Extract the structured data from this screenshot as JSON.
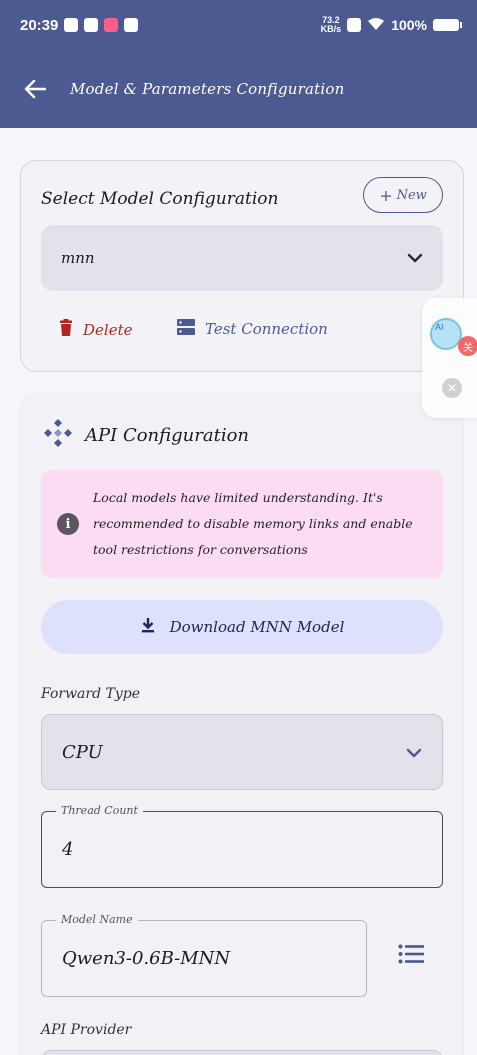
{
  "status_bar": {
    "time": "20:39",
    "net_speed_value": "73.2",
    "net_speed_unit": "KB/s",
    "battery": "100%"
  },
  "app_bar": {
    "title": "Model & Parameters Configuration"
  },
  "model_config": {
    "title": "Select Model Configuration",
    "new_label": "New",
    "selected": "mnn",
    "delete_label": "Delete",
    "test_label": "Test Connection"
  },
  "floating_widget": {
    "ai_label": "AI",
    "badge": "关"
  },
  "api_config": {
    "title": "API Configuration",
    "notice": "Local models have limited understanding. It's recommended to disable memory links and enable tool restrictions for conversations",
    "download_label": "Download MNN Model",
    "forward_type_label": "Forward Type",
    "forward_type_value": "CPU",
    "thread_count_label": "Thread Count",
    "thread_count_value": "4",
    "model_name_label": "Model Name",
    "model_name_value": "Qwen3-0.6B-MNN",
    "api_provider_label": "API Provider"
  },
  "colors": {
    "primary": "#4d5a91",
    "danger": "#b3261e",
    "notice_bg": "#fcdcf3",
    "download_bg": "#dde1fb"
  }
}
